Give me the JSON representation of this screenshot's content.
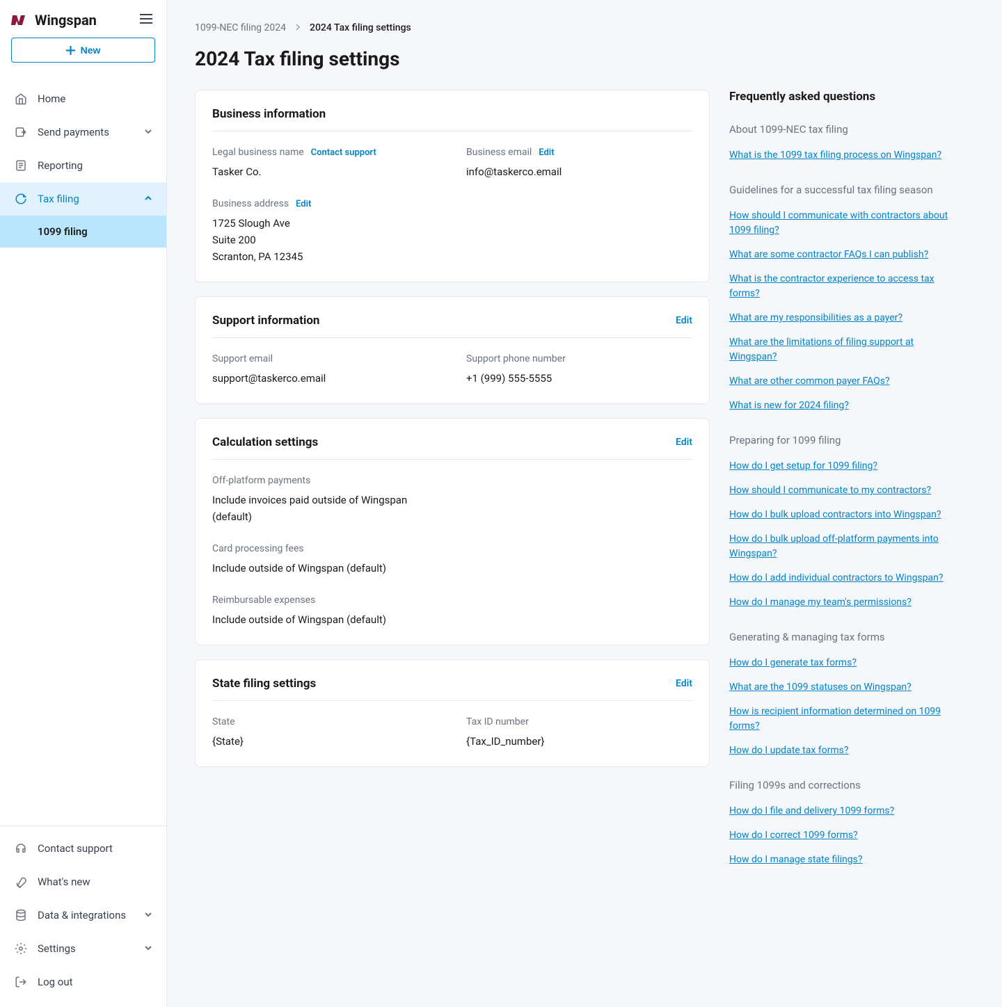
{
  "brand": "Wingspan",
  "newBtn": "New",
  "nav": {
    "home": "Home",
    "sendPayments": "Send payments",
    "reporting": "Reporting",
    "taxFiling": "Tax filing",
    "filing1099": "1099 filing",
    "contactSupport": "Contact support",
    "whatsNew": "What's new",
    "dataIntegrations": "Data & integrations",
    "settings": "Settings",
    "logout": "Log out"
  },
  "breadcrumb": {
    "parent": "1099-NEC filing 2024",
    "current": "2024 Tax filing settings"
  },
  "pageTitle": "2024 Tax filing settings",
  "actions": {
    "edit": "Edit",
    "contactSupport": "Contact support"
  },
  "business": {
    "title": "Business information",
    "legalNameLabel": "Legal business name",
    "legalName": "Tasker Co.",
    "emailLabel": "Business email",
    "email": "info@taskerco.email",
    "addressLabel": "Business address",
    "addressLine1": "1725 Slough Ave",
    "addressLine2": "Suite 200",
    "addressLine3": "Scranton, PA 12345"
  },
  "support": {
    "title": "Support information",
    "emailLabel": "Support email",
    "email": "support@taskerco.email",
    "phoneLabel": "Support phone number",
    "phone": "+1 (999) 555-5555"
  },
  "calc": {
    "title": "Calculation settings",
    "offPlatformLabel": "Off-platform payments",
    "offPlatformValue": "Include invoices paid outside of Wingspan (default)",
    "cardLabel": "Card processing fees",
    "cardValue": "Include outside of Wingspan (default)",
    "reimbLabel": "Reimbursable expenses",
    "reimbValue": "Include outside of Wingspan (default)"
  },
  "state": {
    "title": "State filing settings",
    "stateLabel": "State",
    "stateValue": "{State}",
    "taxIdLabel": "Tax ID number",
    "taxIdValue": "{Tax_ID_number}"
  },
  "faq": {
    "title": "Frequently asked questions",
    "s1": {
      "title": "About 1099-NEC tax filing",
      "q1": "What is the 1099 tax filing process on Wingspan?"
    },
    "s2": {
      "title": "Guidelines for a successful tax filing season",
      "q1": "How should I communicate with contractors about 1099 filing?",
      "q2": "What are some contractor FAQs I can publish?",
      "q3": "What is the contractor experience to access tax forms?",
      "q4": "What are my responsibilities as a payer?",
      "q5": "What are the limitations of filing support at Wingspan?",
      "q6": "What are other common payer FAQs?",
      "q7": "What is new for 2024 filing?"
    },
    "s3": {
      "title": "Preparing for 1099 filing",
      "q1": "How do I get setup for 1099 filing?",
      "q2": "How should I communicate to my contractors?",
      "q3": "How do I bulk upload contractors into Wingspan?",
      "q4": "How do I bulk upload off-platform payments into Wingspan?",
      "q5": "How do I add individual contractors to Wingspan?",
      "q6": "How do I manage my team's permissions?"
    },
    "s4": {
      "title": "Generating & managing tax forms",
      "q1": "How do I generate tax forms?",
      "q2": "What are the 1099 statuses on Wingspan?",
      "q3": "How is recipient information determined on 1099 forms?",
      "q4": "How do I update tax forms?"
    },
    "s5": {
      "title": "Filing 1099s and corrections",
      "q1": "How do I file and delivery 1099 forms?",
      "q2": "How do I correct 1099 forms?",
      "q3": "How do I manage state filings?"
    }
  }
}
